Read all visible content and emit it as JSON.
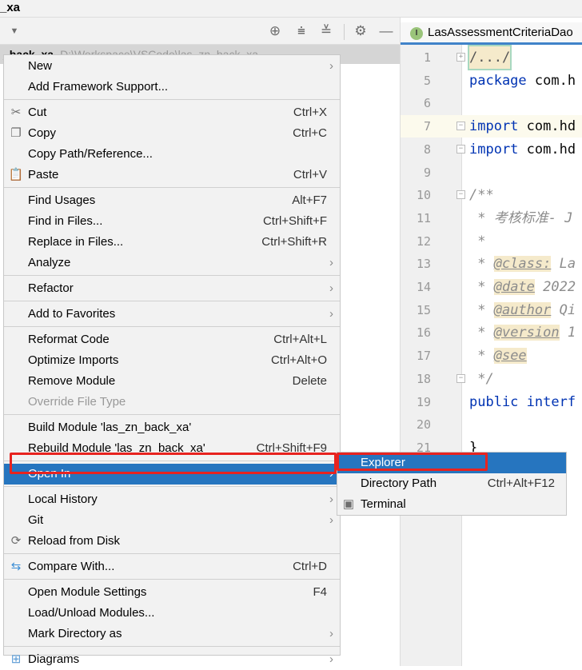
{
  "window": {
    "title": "_xa"
  },
  "toolbar": {
    "icons": [
      "dropdown-arrow-icon",
      "locate-icon",
      "expand-all-icon",
      "collapse-all-icon",
      "gear-icon",
      "minimize-icon"
    ]
  },
  "project_tree": {
    "selected_name": "_back_xa",
    "selected_path": "D:\\Workspace\\VSCode\\las_zn_back_xa"
  },
  "editor": {
    "tab_label": "LasAssessmentCriteriaDao",
    "tab_icon": "I",
    "lines": [
      {
        "n": "1",
        "text": "/.../"
      },
      {
        "n": "5",
        "text": "package com.h"
      },
      {
        "n": "6",
        "text": ""
      },
      {
        "n": "7",
        "text": "import com.hd"
      },
      {
        "n": "8",
        "text": "import com.hd"
      },
      {
        "n": "9",
        "text": ""
      },
      {
        "n": "10",
        "text": "/**"
      },
      {
        "n": "11",
        "text": " * 考核标准- J"
      },
      {
        "n": "12",
        "text": " *"
      },
      {
        "n": "13",
        "text": " * @class: La"
      },
      {
        "n": "14",
        "text": " * @date 2022"
      },
      {
        "n": "15",
        "text": " * @author Qi"
      },
      {
        "n": "16",
        "text": " * @version 1"
      },
      {
        "n": "17",
        "text": " * @see"
      },
      {
        "n": "18",
        "text": " */"
      },
      {
        "n": "19",
        "text": "public interf"
      },
      {
        "n": "20",
        "text": ""
      },
      {
        "n": "21",
        "text": "}"
      }
    ]
  },
  "context_menu": {
    "groups": [
      [
        {
          "label": "New",
          "submenu": true
        },
        {
          "label": "Add Framework Support..."
        }
      ],
      [
        {
          "label": "Cut",
          "shortcut": "Ctrl+X",
          "icon": "scissors-icon"
        },
        {
          "label": "Copy",
          "shortcut": "Ctrl+C",
          "icon": "copy-icon"
        },
        {
          "label": "Copy Path/Reference..."
        },
        {
          "label": "Paste",
          "shortcut": "Ctrl+V",
          "icon": "paste-icon"
        }
      ],
      [
        {
          "label": "Find Usages",
          "shortcut": "Alt+F7"
        },
        {
          "label": "Find in Files...",
          "shortcut": "Ctrl+Shift+F"
        },
        {
          "label": "Replace in Files...",
          "shortcut": "Ctrl+Shift+R"
        },
        {
          "label": "Analyze",
          "submenu": true
        }
      ],
      [
        {
          "label": "Refactor",
          "submenu": true
        }
      ],
      [
        {
          "label": "Add to Favorites",
          "submenu": true
        }
      ],
      [
        {
          "label": "Reformat Code",
          "shortcut": "Ctrl+Alt+L"
        },
        {
          "label": "Optimize Imports",
          "shortcut": "Ctrl+Alt+O"
        },
        {
          "label": "Remove Module",
          "shortcut": "Delete"
        },
        {
          "label": "Override File Type",
          "disabled": true
        }
      ],
      [
        {
          "label": "Build Module 'las_zn_back_xa'"
        },
        {
          "label": "Rebuild Module 'las_zn_back_xa'",
          "shortcut": "Ctrl+Shift+F9"
        }
      ],
      [
        {
          "label": "Open In",
          "submenu": true,
          "selected": true
        }
      ],
      [
        {
          "label": "Local History",
          "submenu": true
        },
        {
          "label": "Git",
          "submenu": true
        },
        {
          "label": "Reload from Disk",
          "icon": "reload-icon"
        }
      ],
      [
        {
          "label": "Compare With...",
          "shortcut": "Ctrl+D",
          "icon": "compare-icon"
        }
      ],
      [
        {
          "label": "Open Module Settings",
          "shortcut": "F4"
        },
        {
          "label": "Load/Unload Modules..."
        },
        {
          "label": "Mark Directory as",
          "submenu": true
        }
      ],
      [
        {
          "label": "Diagrams",
          "submenu": true,
          "icon": "diagrams-icon"
        }
      ]
    ]
  },
  "open_in_submenu": {
    "items": [
      {
        "label": "Explorer",
        "selected": true
      },
      {
        "label": "Directory Path",
        "shortcut": "Ctrl+Alt+F12"
      },
      {
        "label": "Terminal",
        "icon": "terminal-icon"
      }
    ]
  },
  "colors": {
    "selection": "#2675bf",
    "highlight_box": "#e8231f",
    "menu_bg": "#f2f2f2",
    "keyword": "#0033b3"
  }
}
